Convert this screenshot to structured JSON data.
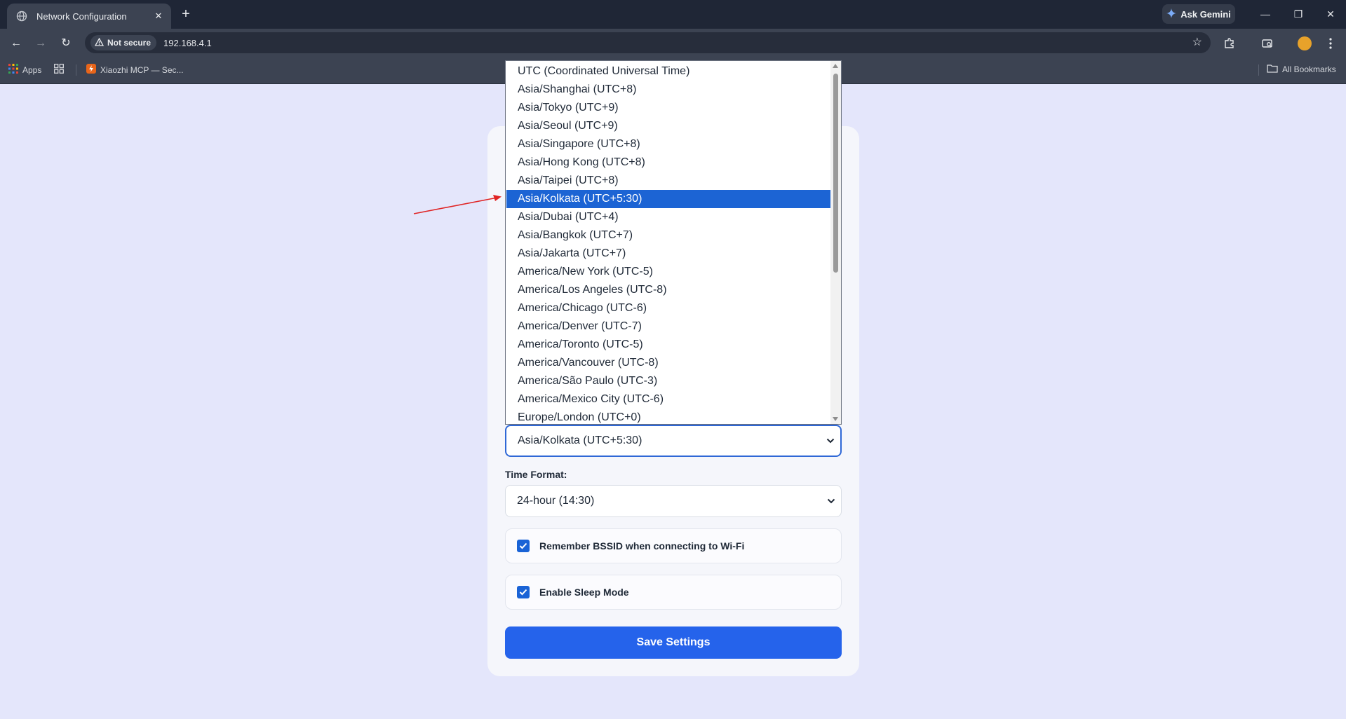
{
  "browser": {
    "tab_title": "Network Configuration",
    "tab_close": "✕",
    "new_tab": "+",
    "gemini_label": "Ask Gemini",
    "security_label": "Not secure",
    "url": "192.168.4.1",
    "window_controls": {
      "minimize": "—",
      "maximize": "❐",
      "close": "✕"
    },
    "nav": {
      "back": "←",
      "forward": "→",
      "reload": "↻"
    },
    "star": "☆"
  },
  "bookmarks": {
    "apps_label": "Apps",
    "items": [
      {
        "label": "Xiaozhi MCP — Sec..."
      }
    ],
    "all_bookmarks_label": "All Bookmarks"
  },
  "timezone": {
    "selected_value": "Asia/Kolkata (UTC+5:30)",
    "selected_index": 7,
    "options": [
      "UTC (Coordinated Universal Time)",
      "Asia/Shanghai (UTC+8)",
      "Asia/Tokyo (UTC+9)",
      "Asia/Seoul (UTC+9)",
      "Asia/Singapore (UTC+8)",
      "Asia/Hong Kong (UTC+8)",
      "Asia/Taipei (UTC+8)",
      "Asia/Kolkata (UTC+5:30)",
      "Asia/Dubai (UTC+4)",
      "Asia/Bangkok (UTC+7)",
      "Asia/Jakarta (UTC+7)",
      "America/New York (UTC-5)",
      "America/Los Angeles (UTC-8)",
      "America/Chicago (UTC-6)",
      "America/Denver (UTC-7)",
      "America/Toronto (UTC-5)",
      "America/Vancouver (UTC-8)",
      "America/São Paulo (UTC-3)",
      "America/Mexico City (UTC-6)",
      "Europe/London (UTC+0)"
    ]
  },
  "time_format": {
    "label": "Time Format:",
    "value": "24-hour (14:30)"
  },
  "checkboxes": [
    {
      "label": "Remember BSSID when connecting to Wi-Fi",
      "checked": true
    },
    {
      "label": "Enable Sleep Mode",
      "checked": true
    }
  ],
  "save_label": "Save Settings",
  "colors": {
    "accent": "#2563eb",
    "selection": "#1c64d4",
    "page_background": "#e4e6fb",
    "annotation": "#e02424"
  }
}
